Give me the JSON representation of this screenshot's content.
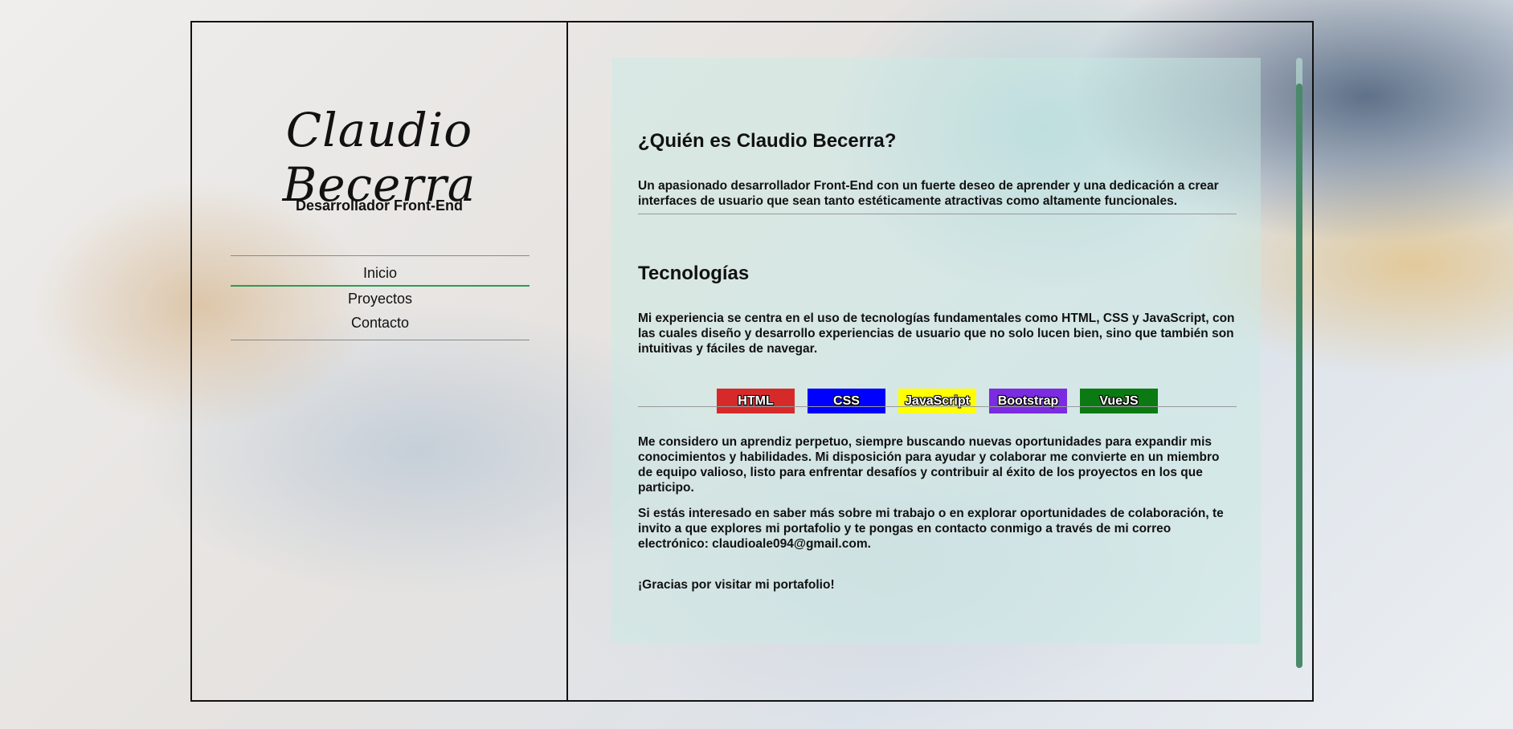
{
  "sidebar": {
    "name": "Claudio Becerra",
    "role": "Desarrollador Front-End",
    "nav": [
      "Inicio",
      "Proyectos",
      "Contacto"
    ]
  },
  "main": {
    "about_heading": "¿Quién es Claudio Becerra?",
    "about_text": "Un apasionado desarrollador Front-End con un fuerte deseo de aprender y una dedicación a crear interfaces de usuario que sean tanto estéticamente atractivas como altamente funcionales.",
    "tech_heading": "Tecnologías",
    "tech_text": "Mi experiencia se centra en el uso de tecnologías fundamentales como HTML, CSS y JavaScript, con las cuales diseño y desarrollo experiencias de usuario que no solo lucen bien, sino que también son intuitivas y fáciles de navegar.",
    "badges": [
      {
        "label": "HTML",
        "color": "#d62a2a"
      },
      {
        "label": "CSS",
        "color": "#0000ff"
      },
      {
        "label": "JavaScript",
        "color": "#ffff00"
      },
      {
        "label": "Bootstrap",
        "color": "#7b2be0"
      },
      {
        "label": "VueJS",
        "color": "#0b7a12"
      }
    ],
    "learner_text": "Me considero un aprendiz perpetuo, siempre buscando nuevas oportunidades para expandir mis conocimientos y habilidades. Mi disposición para ayudar y colaborar me convierte en un miembro de equipo valioso, listo para enfrentar desafíos y contribuir al éxito de los proyectos en los que participo.",
    "contact_text": "Si estás interesado en saber más sobre mi trabajo o en explorar oportunidades de colaboración, te invito a que explores mi portafolio y te pongas en contacto conmigo a través de mi correo electrónico: claudioale094@gmail.com.",
    "thanks_text": "¡Gracias por visitar mi portafolio!"
  },
  "colors": {
    "nav_active_underline": "#2e9a55",
    "scroll_thumb": "#4a8a6a"
  }
}
